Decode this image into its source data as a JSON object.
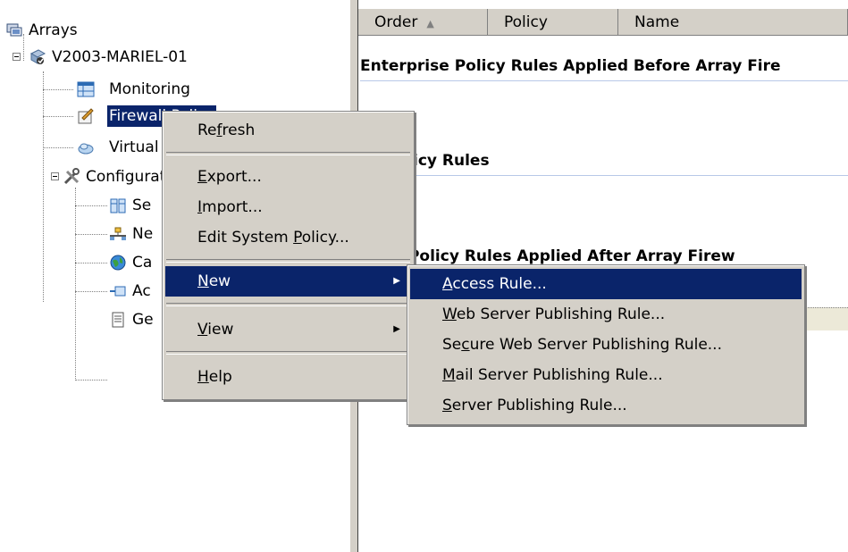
{
  "tree": {
    "root_label": "Arrays",
    "server_label": "V2003-MARIEL-01",
    "items": [
      {
        "label": "Monitoring"
      },
      {
        "label": "Firewall Policy"
      },
      {
        "label": "Virtual"
      },
      {
        "label": "Configuration"
      },
      {
        "label": "Se"
      },
      {
        "label": "Ne"
      },
      {
        "label": "Ca"
      },
      {
        "label": "Ac"
      },
      {
        "label": "Ge"
      }
    ]
  },
  "columns": [
    "Order",
    "Policy",
    "Name"
  ],
  "sections": [
    "Enterprise Policy Rules Applied Before Array Fire",
    "all Policy Rules",
    "prise Policy Rules Applied After Array Firew"
  ],
  "context_menu": {
    "refresh": {
      "pre": "Re",
      "key": "f",
      "post": "resh"
    },
    "export": {
      "pre": "",
      "key": "E",
      "post": "xport..."
    },
    "import": {
      "pre": "",
      "key": "I",
      "post": "mport..."
    },
    "edit_system_policy": {
      "pre": "Edit System ",
      "key": "P",
      "post": "olicy..."
    },
    "new": {
      "pre": "",
      "key": "N",
      "post": "ew"
    },
    "view": {
      "pre": "",
      "key": "V",
      "post": "iew"
    },
    "help": {
      "pre": "",
      "key": "H",
      "post": "elp"
    }
  },
  "submenu": {
    "access_rule": {
      "pre": "",
      "key": "A",
      "post": "ccess Rule..."
    },
    "web_server": {
      "pre": "",
      "key": "W",
      "post": "eb Server Publishing Rule..."
    },
    "secure_web": {
      "pre": "Se",
      "key": "c",
      "post": "ure Web Server Publishing Rule..."
    },
    "mail_server": {
      "pre": "",
      "key": "M",
      "post": "ail Server Publishing Rule..."
    },
    "server_publishing": {
      "pre": "",
      "key": "S",
      "post": "erver Publishing Rule..."
    }
  }
}
